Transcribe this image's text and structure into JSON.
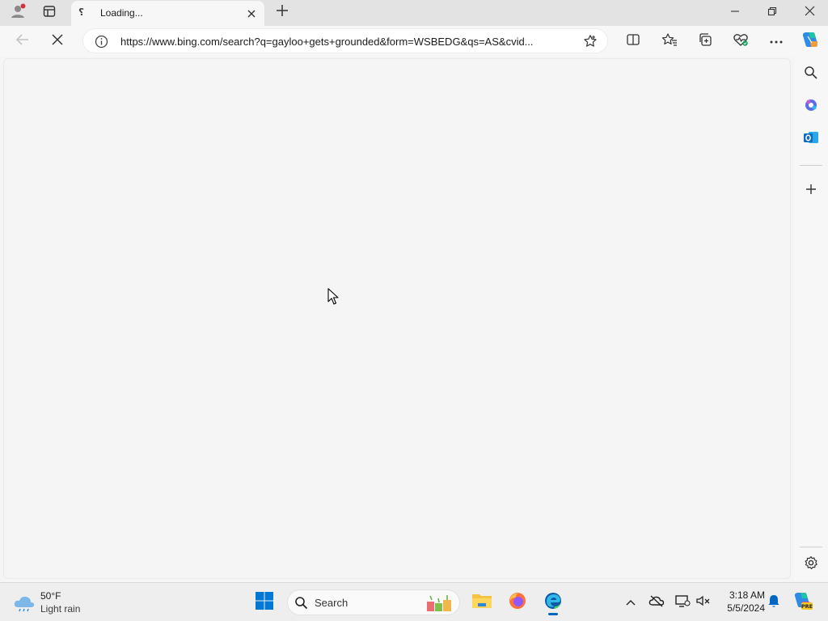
{
  "browser": {
    "tab": {
      "title": "Loading..."
    },
    "address": {
      "url": "https://www.bing.com/search?q=gayloo+gets+grounded&form=WSBEDG&qs=AS&cvid..."
    }
  },
  "taskbar": {
    "weather": {
      "temp": "50°F",
      "desc": "Light rain"
    },
    "search_label": "Search",
    "clock": {
      "time": "3:18 AM",
      "date": "5/5/2024"
    }
  },
  "icons": {
    "titlebar": [
      "profile-icon",
      "tab-actions-icon",
      "tab-close-icon",
      "new-tab-icon",
      "minimize-icon",
      "restore-icon",
      "window-close-icon"
    ],
    "navbar": [
      "back-icon",
      "stop-loading-icon",
      "site-info-icon",
      "favorite-star-icon",
      "split-screen-icon",
      "favorites-icon",
      "collections-icon",
      "browser-essentials-icon",
      "more-icon",
      "copilot-icon"
    ],
    "sidebar": [
      "search-icon",
      "copilot-apps-icon",
      "outlook-icon",
      "add-icon",
      "settings-icon"
    ],
    "taskbar": [
      "windows-start-icon",
      "file-explorer-icon",
      "firefox-icon",
      "edge-icon",
      "chevron-up-icon",
      "onedrive-icon",
      "network-icon",
      "volume-icon",
      "notification-bell-icon",
      "copilot-pre-icon"
    ]
  },
  "colors": {
    "accent": "#0067c0",
    "profile_dot": "#d13438",
    "outlook": "#0f6cbd"
  }
}
